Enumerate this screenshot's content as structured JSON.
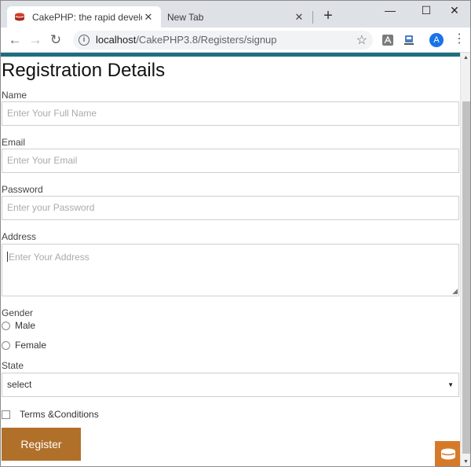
{
  "browser": {
    "tabs": [
      {
        "title": "CakePHP: the rapid development",
        "active": true
      },
      {
        "title": "New Tab",
        "active": false
      }
    ],
    "new_tab": "+",
    "close_glyph": "✕",
    "window_controls": {
      "minimize": "—",
      "maximize": "☐",
      "close": "✕"
    },
    "url_host": "localhost",
    "url_path": "/CakePHP3.8/Registers/signup",
    "avatar_letter": "A",
    "icons": [
      "back-icon",
      "forward-icon",
      "reload-icon",
      "info-icon",
      "star-icon",
      "pdf-extension-icon",
      "save-extension-icon",
      "menu-icon"
    ]
  },
  "page": {
    "heading": "Registration Details",
    "fields": {
      "name_label": "Name",
      "name_placeholder": "Enter Your Full Name",
      "email_label": "Email",
      "email_placeholder": "Enter Your Email",
      "password_label": "Password",
      "password_placeholder": "Enter your Password",
      "address_label": "Address",
      "address_placeholder": "Enter Your Address"
    },
    "gender": {
      "label": "Gender",
      "options": [
        "Male",
        "Female"
      ]
    },
    "state": {
      "label": "State",
      "selected": "select"
    },
    "terms_label": "Terms &Conditions",
    "submit_label": "Register"
  },
  "colors": {
    "topbar": "#1d6f80",
    "button": "#b0702a",
    "cake_badge": "#d67a2a"
  }
}
